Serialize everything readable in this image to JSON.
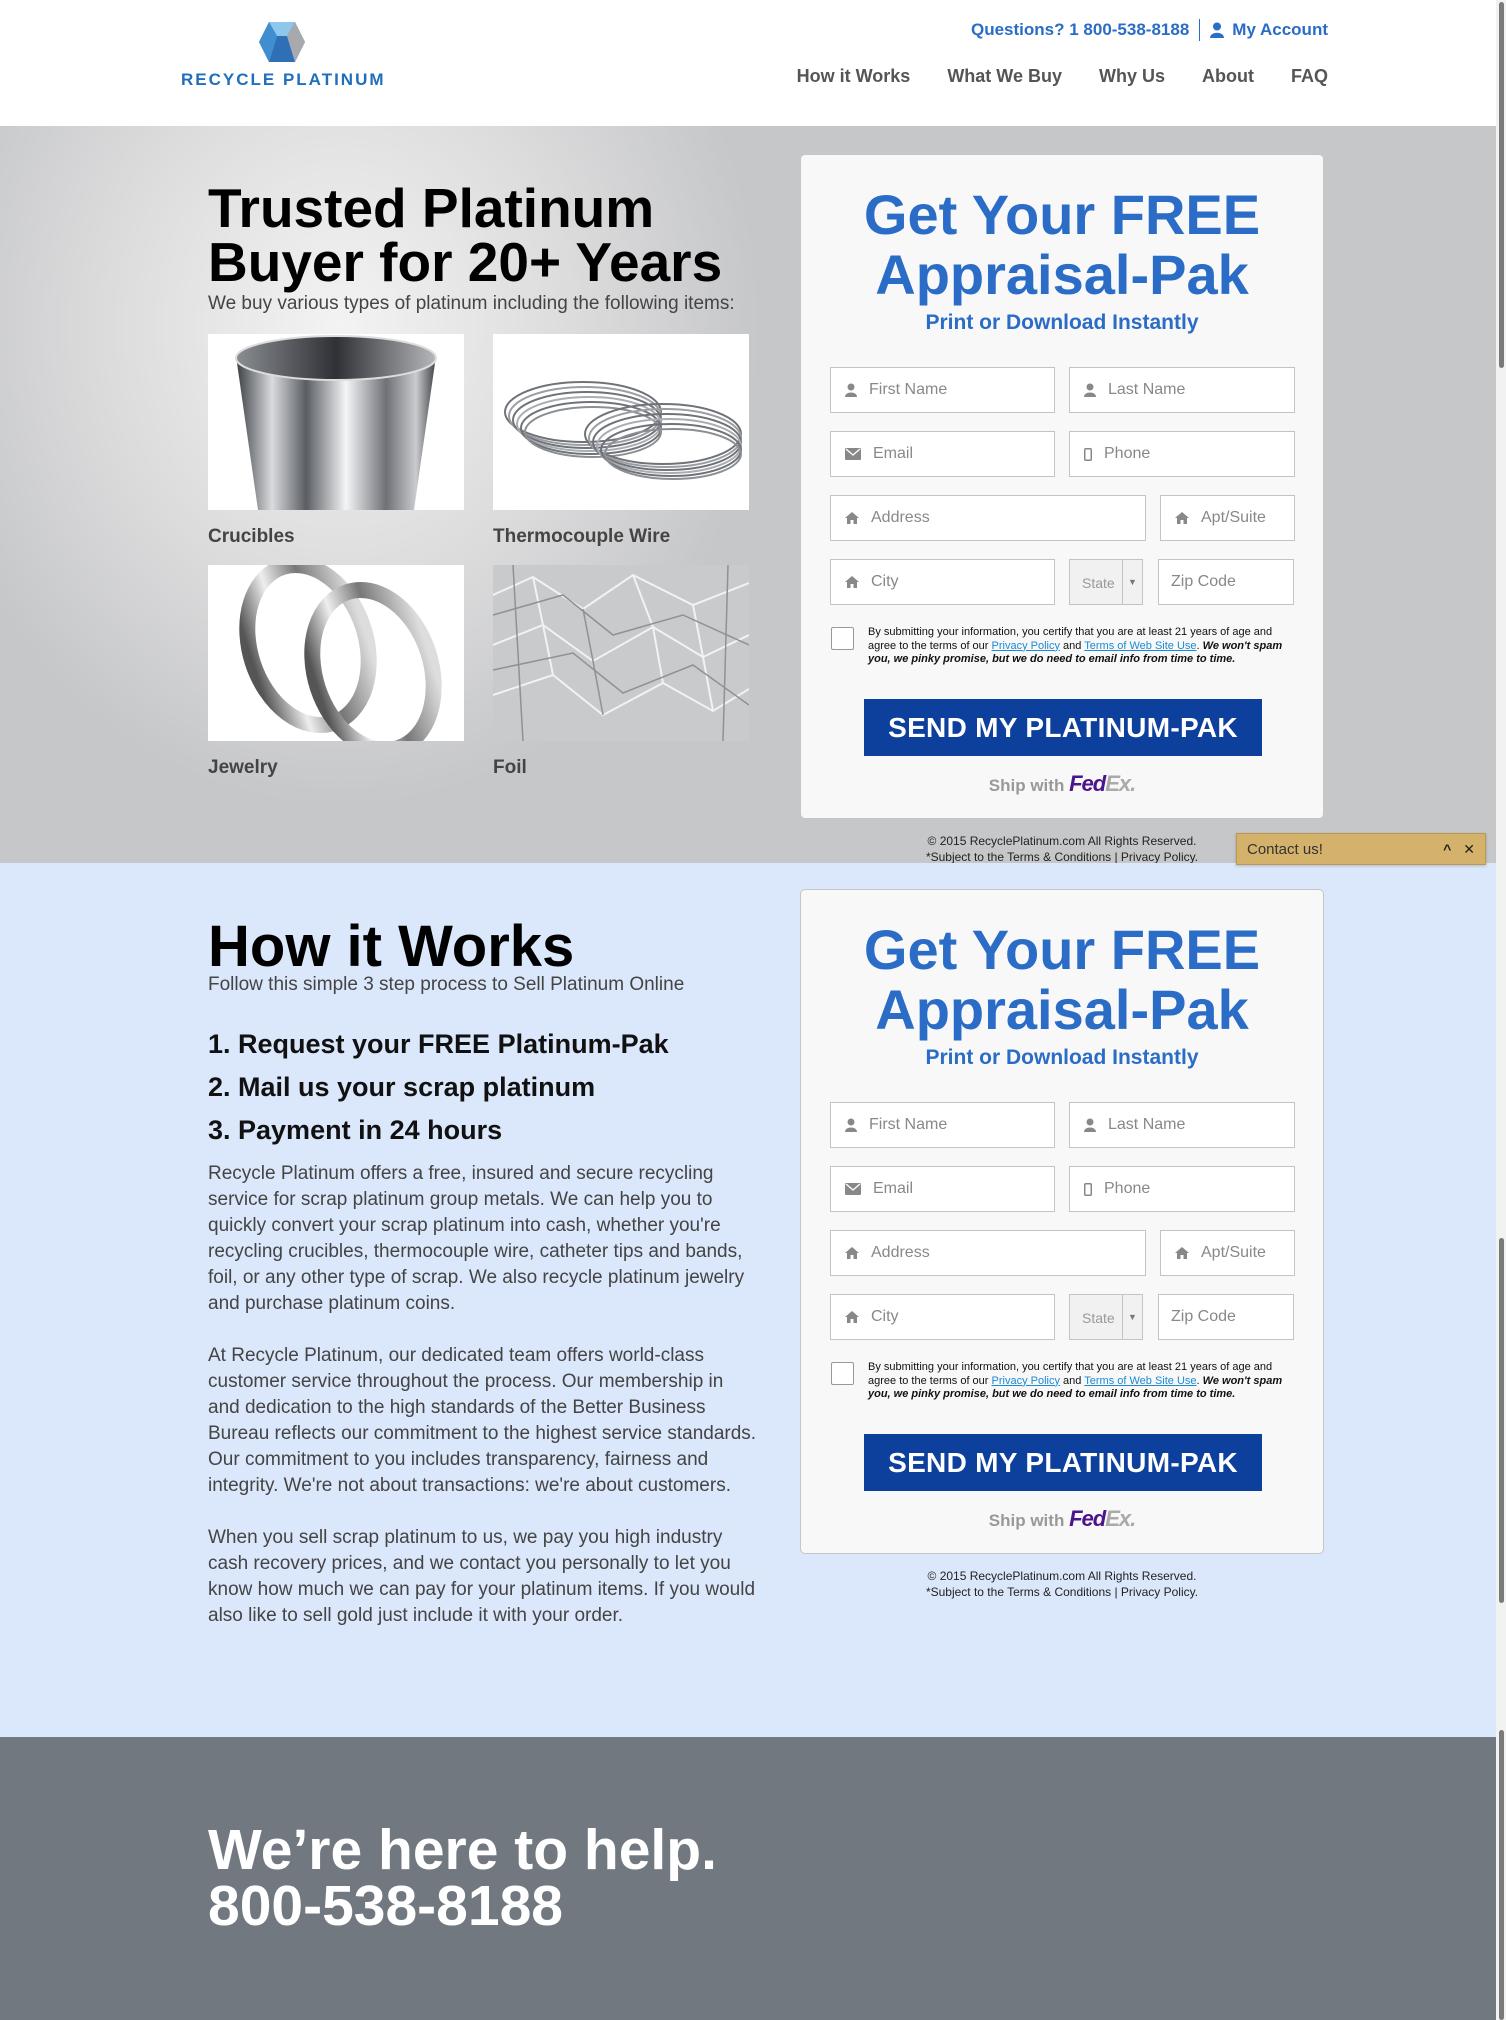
{
  "header": {
    "logo_text": "RECYCLE PLATINUM",
    "questions": "Questions? 1 800-538-8188",
    "account": "My Account",
    "nav": [
      "How it Works",
      "What We Buy",
      "Why Us",
      "About",
      "FAQ"
    ]
  },
  "hero": {
    "title": "Trusted Platinum Buyer for 20+ Years",
    "subtitle": "We buy various types of platinum including the following items:",
    "items": [
      {
        "label": "Crucibles"
      },
      {
        "label": "Thermocouple Wire"
      },
      {
        "label": "Jewelry"
      },
      {
        "label": "Foil"
      }
    ]
  },
  "form": {
    "title": "Get Your FREE Appraisal-Pak",
    "subtitle": "Print or Download Instantly",
    "fields": {
      "first_name": "First Name",
      "last_name": "Last Name",
      "email": "Email",
      "phone": "Phone",
      "address": "Address",
      "apt": "Apt/Suite",
      "city": "City",
      "state": "State",
      "zip": "Zip Code"
    },
    "terms_1": "By submitting your information, you certify that you are at least 21 years of age and agree to the terms of our",
    "privacy_link": "Privacy Policy",
    "and": "and",
    "terms_link": "Terms of Web Site Use",
    "terms_2": "We won't spam you, we pinky promise, but we do need to email info from time to time.",
    "button": "SEND MY PLATINUM-PAK",
    "ship_with": "Ship with",
    "fedex_fe": "Fed",
    "fedex_ex": "Ex.",
    "copyright": "© 2015 RecyclePlatinum.com All Rights Reserved.",
    "subject": "*Subject to the Terms & Conditions | Privacy Policy."
  },
  "contact_widget": {
    "label": "Contact us!",
    "expand": "^",
    "close": "✕"
  },
  "how": {
    "title": "How it Works",
    "subtitle": "Follow this simple 3 step process to Sell Platinum Online",
    "steps": [
      "1. Request your FREE Platinum-Pak",
      "2. Mail us your scrap platinum",
      "3. Payment in 24 hours"
    ],
    "paragraphs": [
      "Recycle Platinum offers a free, insured and secure recycling service for scrap platinum group metals. We can help you to quickly convert your scrap platinum into cash, whether you're recycling crucibles, thermocouple wire, catheter tips and bands, foil, or any other type of scrap. We also recycle platinum jewelry and purchase platinum coins.",
      "At Recycle Platinum, our dedicated team offers world-class customer service throughout the process. Our membership in and dedication to the high standards of the Better Business Bureau reflects our commitment to the highest service standards. Our commitment to you includes transparency, fairness and integrity. We're not about transactions: we're about customers.",
      "When you sell scrap platinum to us, we pay you high industry cash recovery prices, and we contact you personally to let you know how much we can pay for your platinum items. If you would also like to sell gold just include it with your order."
    ]
  },
  "help": {
    "line1": "We’re here to help.",
    "line2": "800-538-8188"
  },
  "colors": {
    "brand_blue": "#2a6cc6",
    "button_blue": "#0d3f9c",
    "how_bg": "#dbe7fb",
    "help_bg": "#727880",
    "contact_bg": "#d4b26b"
  }
}
